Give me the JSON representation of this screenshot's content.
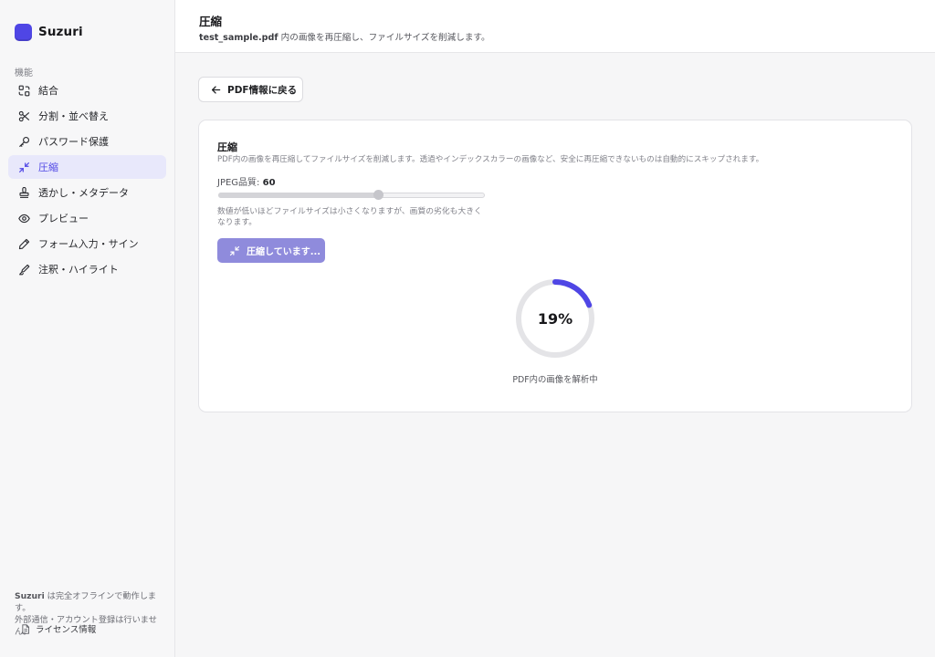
{
  "app": {
    "name": "Suzuri",
    "accent": "#4f46e5"
  },
  "sidebar": {
    "section_label": "機能",
    "items": [
      {
        "label": "結合",
        "icon": "merge-icon",
        "active": false
      },
      {
        "label": "分割・並べ替え",
        "icon": "scissors-icon",
        "active": false
      },
      {
        "label": "パスワード保護",
        "icon": "key-icon",
        "active": false
      },
      {
        "label": "圧縮",
        "icon": "compress-icon",
        "active": true
      },
      {
        "label": "透かし・メタデータ",
        "icon": "stamp-icon",
        "active": false
      },
      {
        "label": "プレビュー",
        "icon": "eye-icon",
        "active": false
      },
      {
        "label": "フォーム入力・サイン",
        "icon": "pen-icon",
        "active": false
      },
      {
        "label": "注釈・ハイライト",
        "icon": "highlighter-icon",
        "active": false
      }
    ],
    "footer": {
      "brand": "Suzuri",
      "line1_rest": " は完全オフラインで動作します。",
      "line2": "外部通信・アカウント登録は行いません。",
      "license_label": "ライセンス情報"
    }
  },
  "header": {
    "title": "圧縮",
    "file_name": "test_sample.pdf",
    "subtitle_rest": " 内の画像を再圧縮し、ファイルサイズを削減します。"
  },
  "back_button": {
    "label": "PDF情報に戻る"
  },
  "card": {
    "title": "圧縮",
    "description": "PDF内の画像を再圧縮してファイルサイズを削減します。透過やインデックスカラーの画像など、安全に再圧縮できないものは自動的にスキップされます。",
    "quality_label": "JPEG品質: ",
    "quality_value": "60",
    "slider": {
      "min": 0,
      "max": 100,
      "value": 60
    },
    "hint": "数値が低いほどファイルサイズは小さくなりますが、画質の劣化も大きくなります。",
    "compress_button_label": "圧縮しています...",
    "progress": {
      "value": 19,
      "label": "19%",
      "caption": "PDF内の画像を解析中"
    }
  }
}
